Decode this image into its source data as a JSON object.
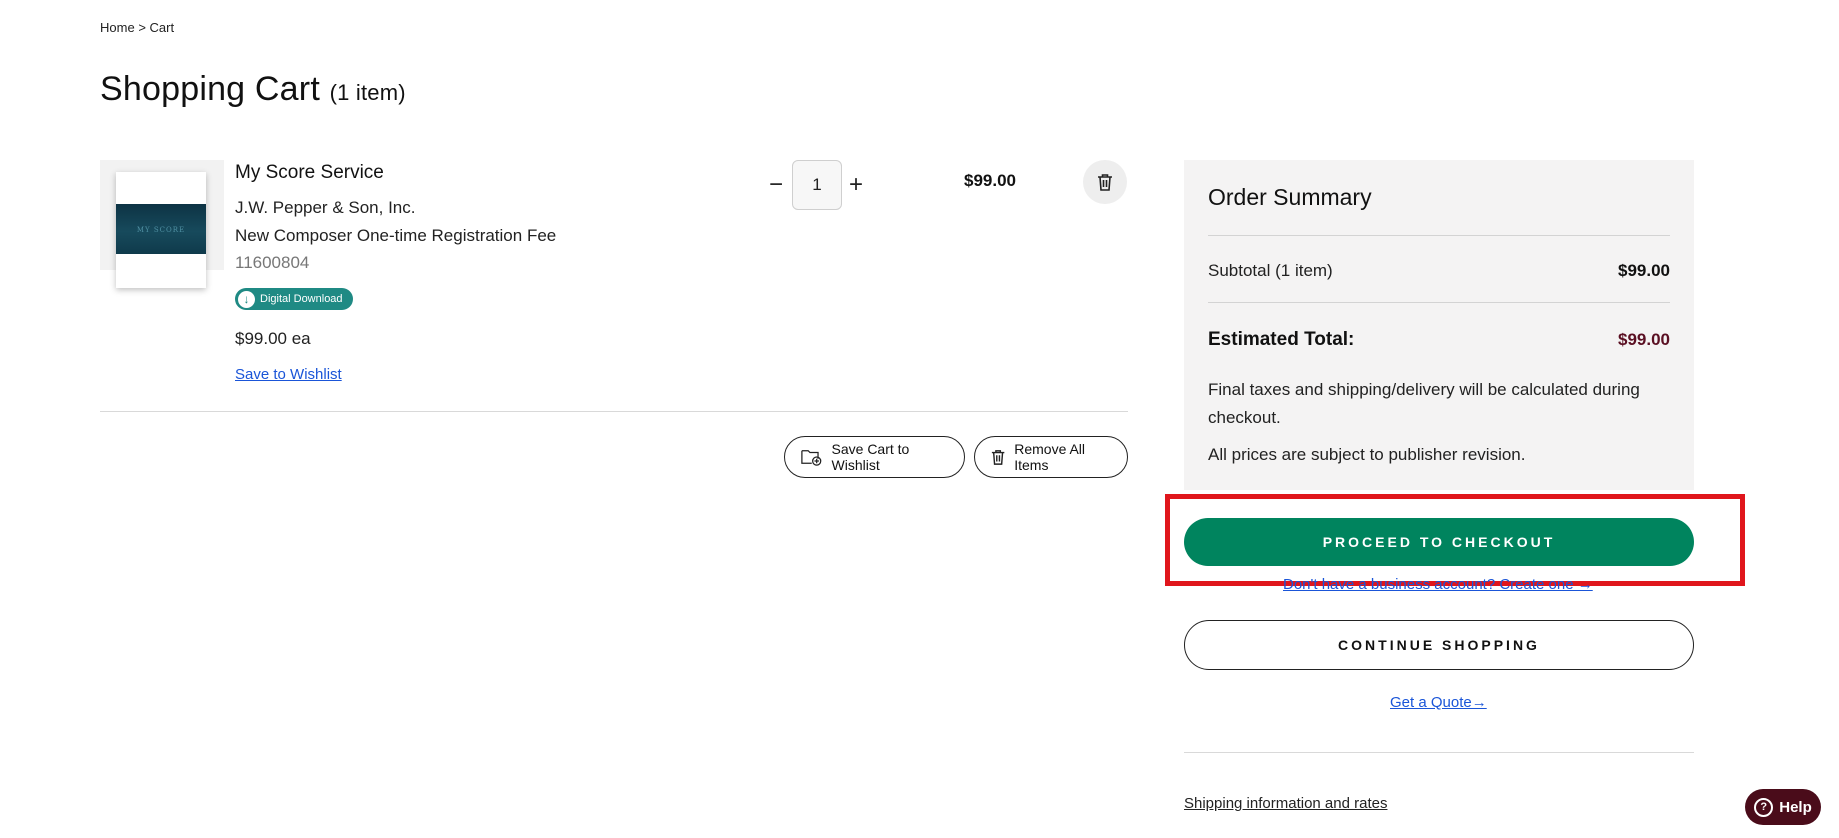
{
  "breadcrumb": {
    "home": "Home",
    "separator": ">",
    "current": "Cart"
  },
  "page": {
    "title": "Shopping Cart",
    "item_count": "(1 item)"
  },
  "cart_item": {
    "name": "My Score Service",
    "publisher": "J.W. Pepper & Son, Inc.",
    "description": "New Composer One-time Registration Fee",
    "sku": "11600804",
    "badge": "Digital Download",
    "unit_price": "$99.00 ea",
    "save_to_wishlist": "Save to Wishlist",
    "quantity": "1",
    "qty_minus": "−",
    "qty_plus": "+",
    "line_total": "$99.00",
    "thumbnail_text": "MY SCORE"
  },
  "cart_actions": {
    "save_cart": "Save Cart to Wishlist",
    "remove_all": "Remove All Items"
  },
  "order_summary": {
    "title": "Order Summary",
    "subtotal_label": "Subtotal (1 item)",
    "subtotal_value": "$99.00",
    "estimated_label": "Estimated Total:",
    "estimated_value": "$99.00",
    "tax_note": "Final taxes and shipping/delivery will be calculated during checkout.",
    "price_note": "All prices are subject to publisher revision.",
    "checkout_button": "PROCEED TO CHECKOUT",
    "business_link": "Don't have a business account? Create one →",
    "continue_button": "CONTINUE SHOPPING",
    "quote_link": "Get a Quote→",
    "shipping_link": "Shipping information and rates"
  },
  "help": {
    "label": "Help"
  },
  "colors": {
    "checkout_green": "#00845e",
    "badge_teal": "#1f8a84",
    "estimated_total_maroon": "#5a0f22",
    "help_maroon": "#4a0c1a",
    "highlight_red": "#e0161c",
    "link_blue": "#1a55d8",
    "summary_bg": "#f4f3f3"
  },
  "icons": {
    "delete_item": "trash-icon",
    "save_cart": "folder-plus-icon",
    "remove_all": "trash-icon",
    "badge": "download-arrow-icon",
    "help": "question-circle-icon"
  }
}
